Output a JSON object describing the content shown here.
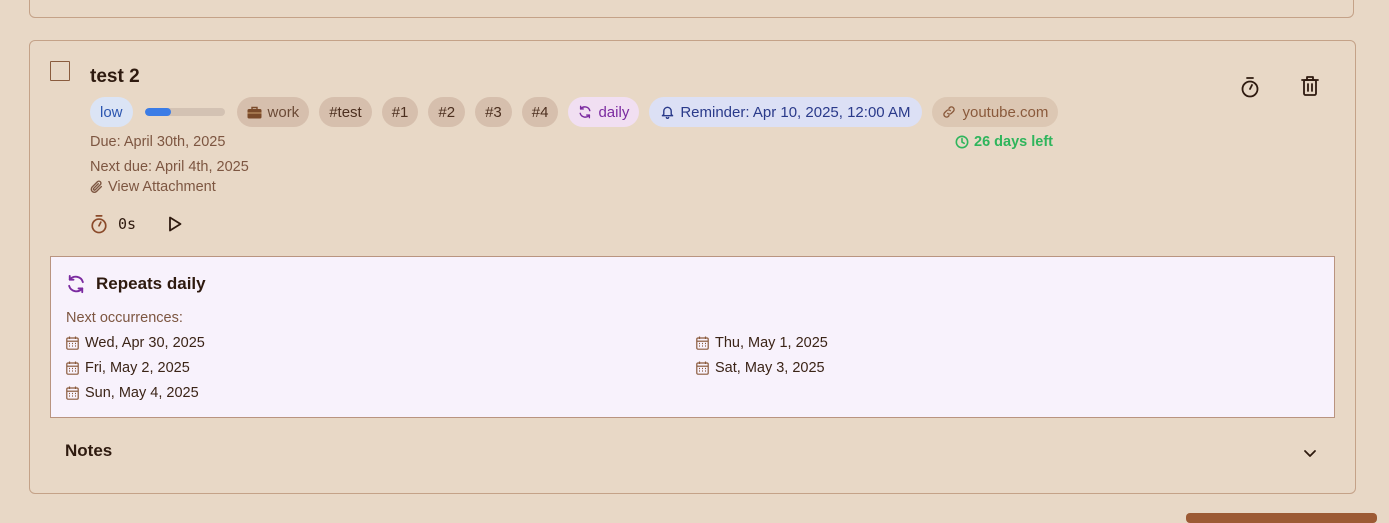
{
  "task": {
    "title": "test 2",
    "priority": "low",
    "progress_fraction": 0.33,
    "category": "work",
    "tags": [
      "#test",
      "#1",
      "#2",
      "#3",
      "#4"
    ],
    "recurrence_label": "daily",
    "reminder": "Reminder: Apr 10, 2025, 12:00 AM",
    "link_label": "youtube.com",
    "due": "Due: April 30th, 2025",
    "next_due": "Next due: April 4th, 2025",
    "attachment_label": "View Attachment",
    "days_left": "26 days left",
    "timer_value": "0s"
  },
  "repeat": {
    "title": "Repeats daily",
    "next_label": "Next occurrences:",
    "occurrences": [
      "Wed, Apr 30, 2025",
      "Thu, May 1, 2025",
      "Fri, May 2, 2025",
      "Sat, May 3, 2025",
      "Sun, May 4, 2025"
    ]
  },
  "notes": {
    "label": "Notes"
  },
  "icons": {
    "timer": "stopwatch-icon",
    "delete": "trash-icon",
    "briefcase": "briefcase-icon",
    "recur": "refresh-icon",
    "bell": "bell-icon",
    "link": "link-icon",
    "clock": "clock-icon",
    "paperclip": "paperclip-icon",
    "play": "play-icon",
    "calendar": "calendar-icon",
    "chevron": "chevron-down-icon"
  },
  "colors": {
    "background": "#e8d8c6",
    "border": "#c4a288",
    "priority_low": "#2c56b0",
    "progress": "#3b7ce6",
    "recurrence": "#7b2aa0",
    "reminder": "#2a3a8a",
    "days_left": "#2fb55c",
    "repeat_bg": "#f8f2fc"
  }
}
